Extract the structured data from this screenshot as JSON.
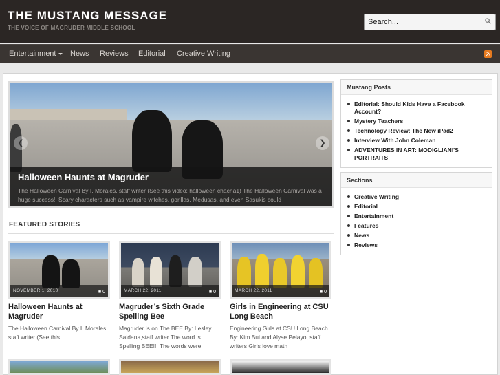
{
  "site": {
    "title": "THE MUSTANG MESSAGE",
    "tagline": "THE VOICE OF MAGRUDER MIDDLE SCHOOL"
  },
  "search": {
    "placeholder": "Search..."
  },
  "nav": {
    "items": [
      {
        "label": "Entertainment"
      },
      {
        "label": "News"
      },
      {
        "label": "Reviews"
      },
      {
        "label": "Editorial"
      },
      {
        "label": "Creative Writing"
      }
    ],
    "rss_icon": "rss-icon"
  },
  "slider": {
    "title": "Halloween Haunts at Magruder",
    "excerpt": "The Halloween Carnival By I. Morales, staff writer                    (See this video: halloween chacha1) The Halloween Carnival was a huge success!!  Scary characters such as vampire witches, gorillas, Medusas, and even Sasukis could",
    "prev_icon": "arrow-left-icon",
    "next_icon": "arrow-right-icon"
  },
  "featured": {
    "heading": "FEATURED STORIES",
    "cards": [
      {
        "date": "NOVEMBER 1, 2010",
        "comments": "0",
        "title": "Halloween Haunts at Magruder",
        "excerpt": "The Halloween Carnival By I. Morales, staff writer                    (See this"
      },
      {
        "date": "MARCH 22, 2011",
        "comments": "0",
        "title": "Magruder’s Sixth Grade Spelling Bee",
        "excerpt": "Magruder is on The BEE By: Lesley Saldana,staff writer   The word is… Spelling BEE!!! The words were"
      },
      {
        "date": "MARCH 22, 2011",
        "comments": "0",
        "title": "Girls in Engineering at CSU Long Beach",
        "excerpt": "Engineering Girls at CSU Long Beach By: Kim Bui and Alyse Pelayo, staff writers Girls love math"
      }
    ]
  },
  "sidebar": {
    "posts": {
      "title": "Mustang Posts",
      "items": [
        "Editorial: Should Kids Have a Facebook Account?",
        "Mystery Teachers",
        "Technology Review: The New iPad2",
        "Interview With John Coleman",
        "ADVENTURES IN ART: MODIGLIANI'S PORTRAITS"
      ]
    },
    "sections": {
      "title": "Sections",
      "items": [
        "Creative Writing",
        "Editorial",
        "Entertainment",
        "Features",
        "News",
        "Reviews"
      ]
    }
  },
  "colors": {
    "header_bg": "#2b2624",
    "nav_bg": "#3a3532",
    "rss": "#e67a1f"
  }
}
